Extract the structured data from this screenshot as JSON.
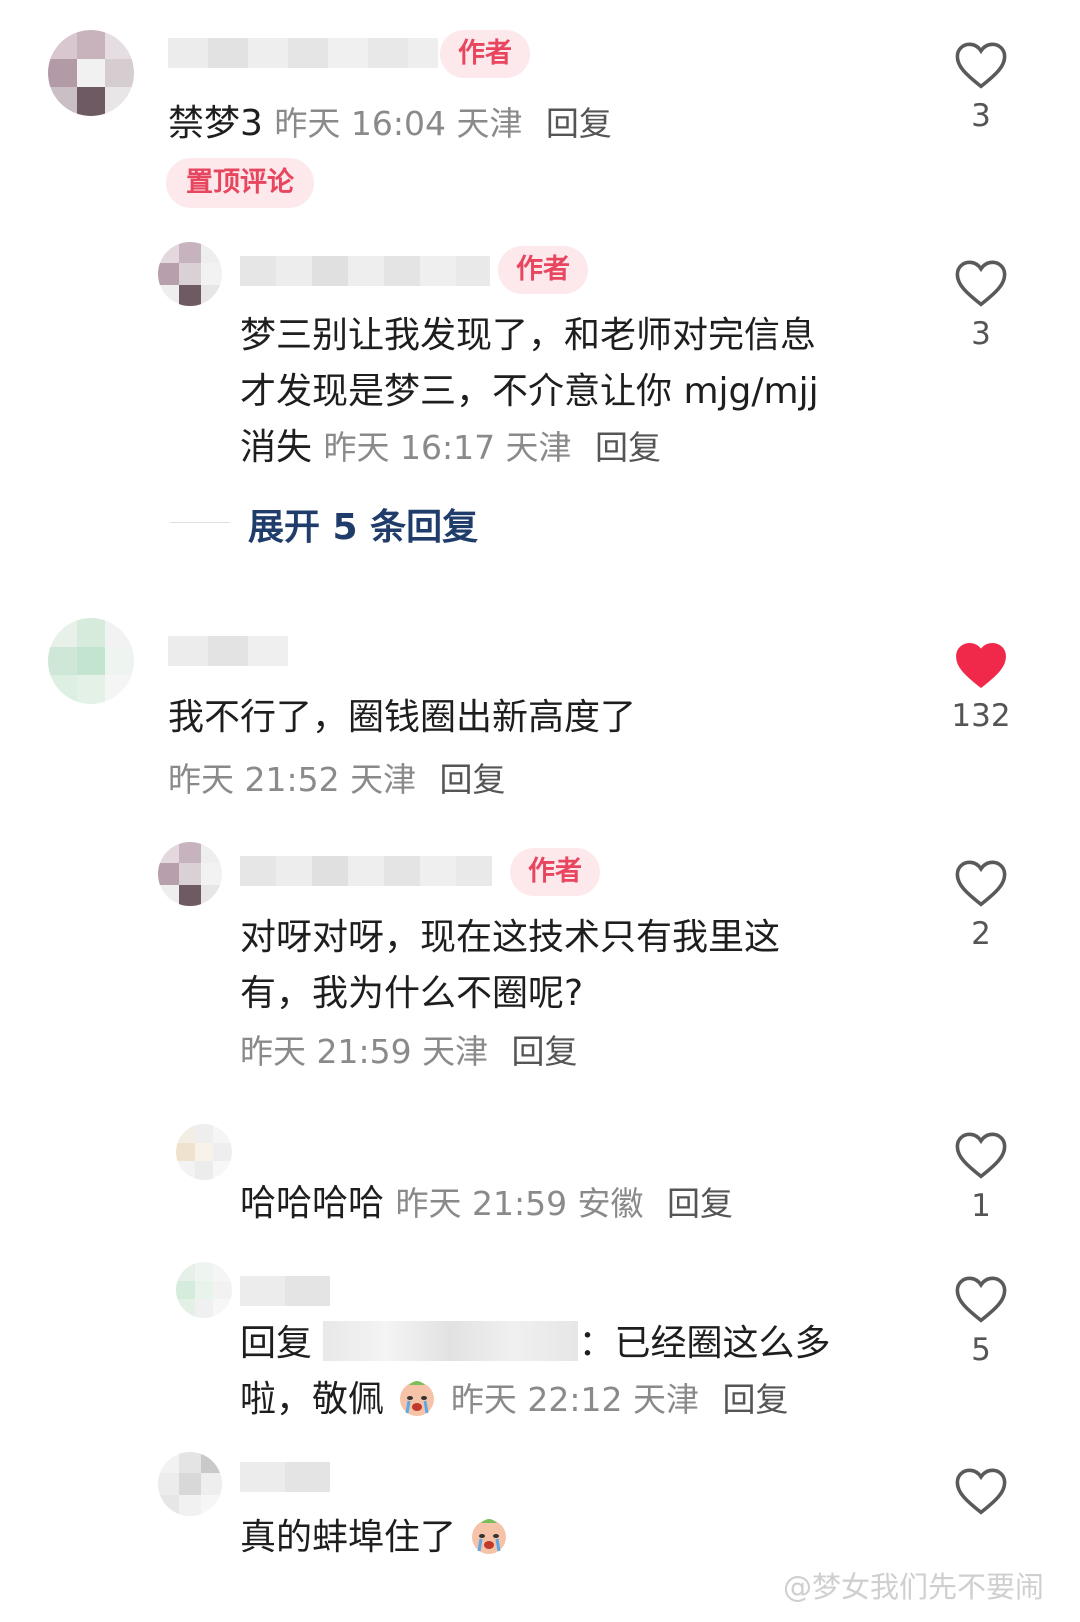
{
  "comments": [
    {
      "author_badge": "作者",
      "text": "禁梦3",
      "time": "昨天 16:04 天津",
      "reply": "回复",
      "pin": "置顶评论",
      "likes": "3"
    },
    {
      "author_badge": "作者",
      "text_line1": "梦三别让我发现了，和老师对完信息",
      "text_line2": "才发现是梦三，不介意让你 mjg/mjj",
      "text_line3": "消失",
      "time": "昨天 16:17 天津",
      "reply": "回复",
      "likes": "3"
    },
    {
      "expand": "展开 5 条回复"
    },
    {
      "text": "我不行了，圈钱圈出新高度了",
      "time": "昨天 21:52 天津",
      "reply": "回复",
      "likes": "132",
      "liked": true
    },
    {
      "author_badge": "作者",
      "text_line1": "对呀对呀，现在这技术只有我里这",
      "text_line2": "有，我为什么不圈呢?",
      "time": "昨天 21:59 天津",
      "reply": "回复",
      "likes": "2"
    },
    {
      "text": "哈哈哈哈",
      "time": "昨天 21:59 安徽",
      "reply": "回复",
      "likes": "1"
    },
    {
      "reply_prefix": "回复",
      "text_after": "：已经圈这么多",
      "text_line2": "啦，敬佩",
      "time": "昨天 22:12 天津",
      "reply": "回复",
      "likes": "5"
    },
    {
      "text": "真的蚌埠住了"
    }
  ],
  "watermark": "@梦女我们先不要闹",
  "colors": {
    "author_badge_bg": "#fde8eb",
    "author_badge_text": "#e8465f",
    "liked_heart": "#f0284a",
    "expand_link": "#1f3c6b"
  },
  "icons": [
    "heart-outline-icon",
    "heart-filled-icon",
    "crying-emoji-icon"
  ]
}
